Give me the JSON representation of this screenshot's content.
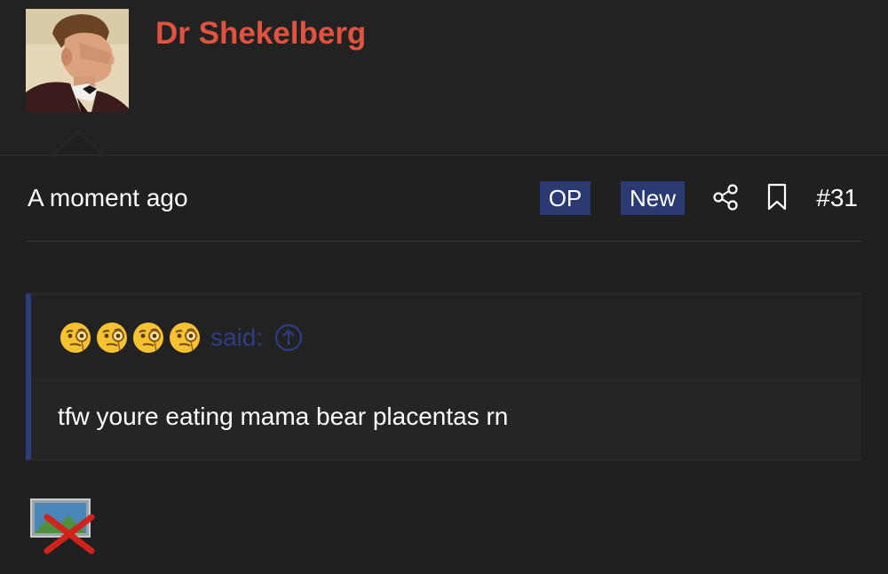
{
  "post": {
    "author": "Dr Shekelberg",
    "timestamp": "A moment ago",
    "badges": {
      "op": "OP",
      "new": "New"
    },
    "post_number": "#31",
    "quote": {
      "said_label": "said:",
      "author_icons": [
        "face-with-monocle-icon",
        "face-with-monocle-icon",
        "face-with-monocle-icon",
        "face-with-monocle-icon"
      ],
      "text": "tfw youre eating mama bear placentas rn"
    }
  },
  "colors": {
    "background": "#202020",
    "username": "#e0533f",
    "badge": "#2b3a72",
    "quote_accent": "#2d3c7a",
    "said_text": "#2d3e86"
  },
  "icons": {
    "share": "share-icon",
    "bookmark": "bookmark-icon",
    "jump_to_quote": "arrow-up-circle-icon",
    "broken_image": "broken-image-icon"
  }
}
